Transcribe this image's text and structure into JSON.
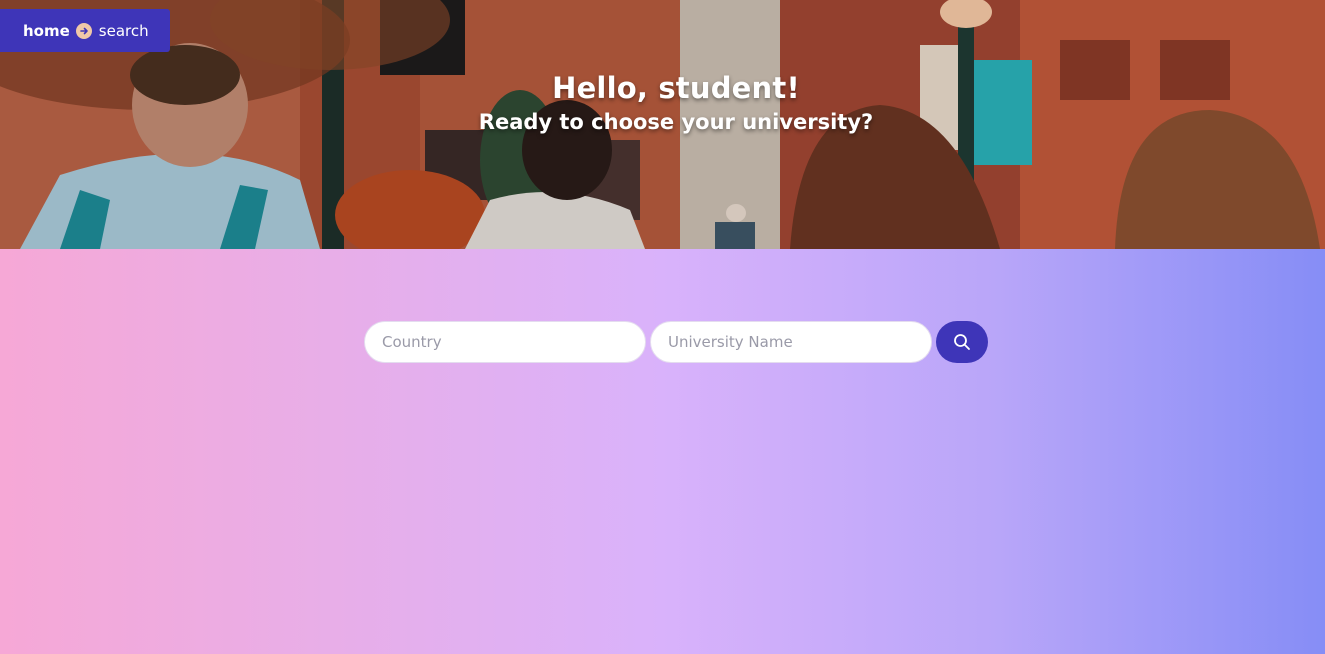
{
  "breadcrumb": {
    "home_label": "home",
    "current_label": "search",
    "separator_icon": "arrow-right-circle-icon"
  },
  "hero": {
    "title": "Hello, student!",
    "subtitle": "Ready to choose your university?"
  },
  "search": {
    "country_placeholder": "Country",
    "country_value": "",
    "university_placeholder": "University Name",
    "university_value": "",
    "button_icon": "search-icon"
  },
  "colors": {
    "accent": "#3e35b8",
    "gradient_start": "#f6a8d6",
    "gradient_mid": "#d9b2fb",
    "gradient_end": "#868df6"
  }
}
